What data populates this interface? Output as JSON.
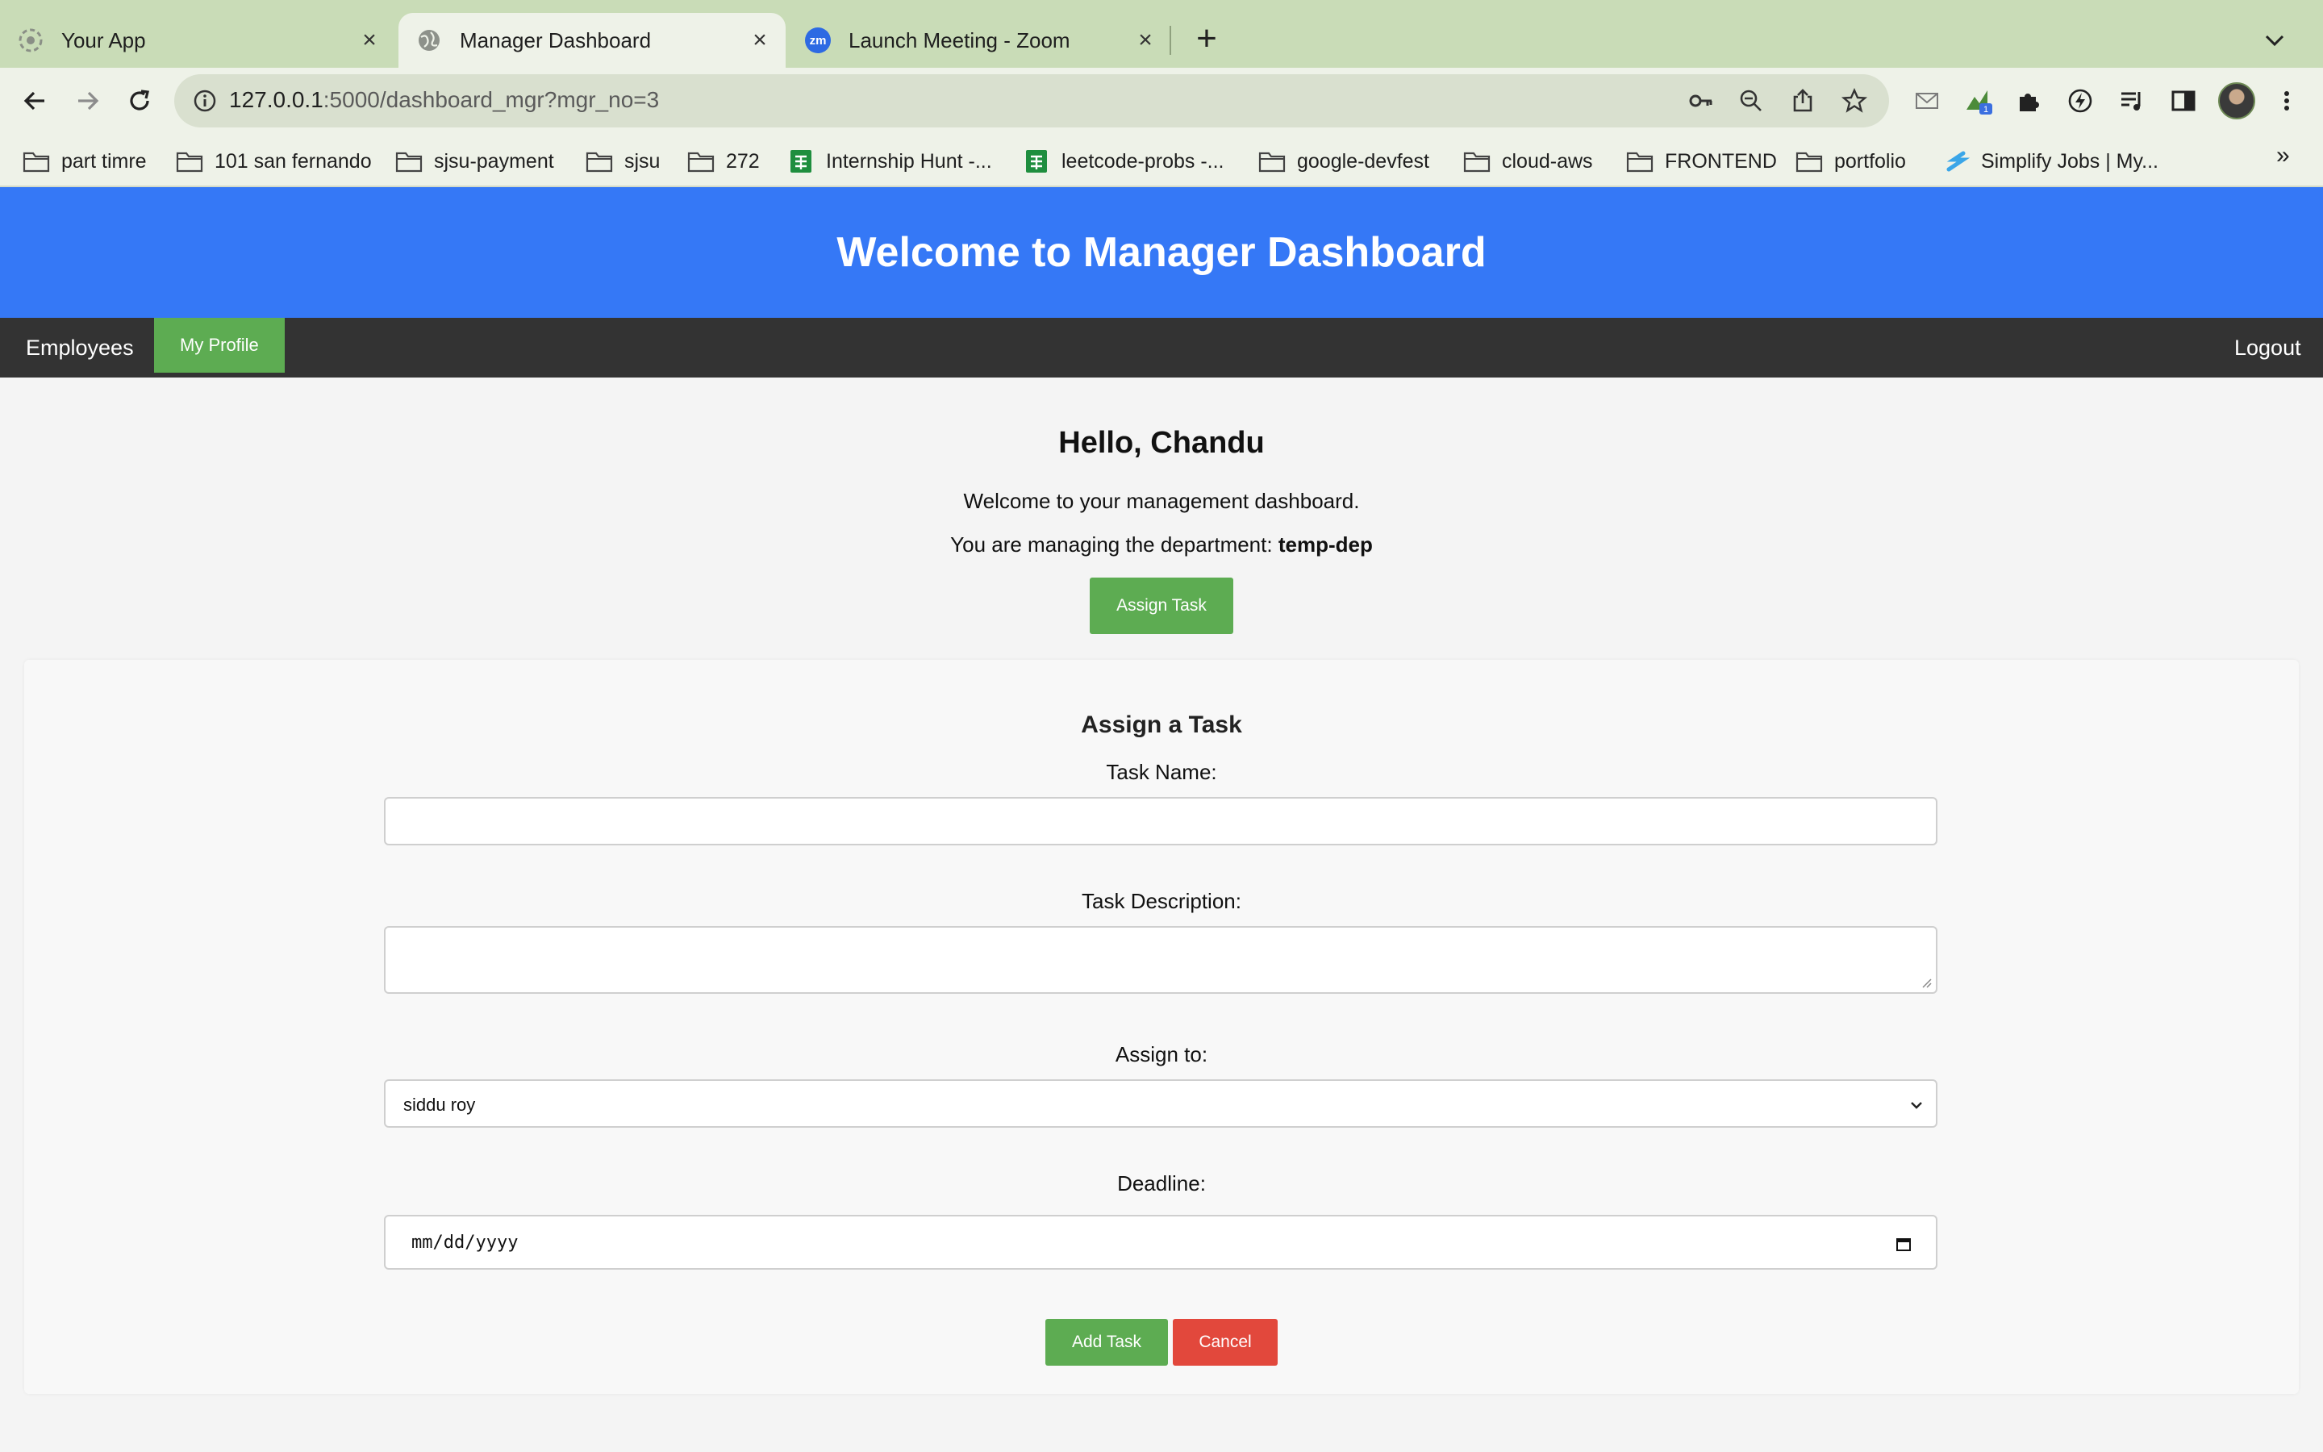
{
  "browser": {
    "tabs": [
      {
        "title": "Your App",
        "icon": "loading-spinner-icon"
      },
      {
        "title": "Manager Dashboard",
        "icon": "globe-icon"
      },
      {
        "title": "Launch Meeting - Zoom",
        "icon": "zoom-icon",
        "icon_text": "zm"
      }
    ],
    "new_tab": "+",
    "url_host": "127.0.0.1",
    "url_rest": ":5000/dashboard_mgr?mgr_no=3",
    "extension_badge": "1",
    "bookmarks": [
      {
        "label": "part timre",
        "icon": "folder-icon"
      },
      {
        "label": "101 san fernando",
        "icon": "folder-icon"
      },
      {
        "label": "sjsu-payment",
        "icon": "folder-icon"
      },
      {
        "label": "sjsu",
        "icon": "folder-icon"
      },
      {
        "label": "272",
        "icon": "folder-icon"
      },
      {
        "label": "Internship Hunt -...",
        "icon": "sheets-icon"
      },
      {
        "label": "leetcode-probs -...",
        "icon": "sheets-icon"
      },
      {
        "label": "google-devfest",
        "icon": "folder-icon"
      },
      {
        "label": "cloud-aws",
        "icon": "folder-icon"
      },
      {
        "label": "FRONTEND",
        "icon": "folder-icon"
      },
      {
        "label": "portfolio",
        "icon": "folder-icon"
      },
      {
        "label": "Simplify Jobs | My...",
        "icon": "simplify-icon"
      }
    ],
    "bookmarks_more": "»"
  },
  "header": {
    "title": "Welcome to Manager Dashboard"
  },
  "nav": {
    "employees": "Employees",
    "my_profile": "My Profile",
    "logout": "Logout"
  },
  "greeting": {
    "title": "Hello, Chandu",
    "welcome": "Welcome to your management dashboard.",
    "managing_prefix": "You are managing the department:",
    "department": "temp-dep",
    "assign_button": "Assign Task"
  },
  "form": {
    "title": "Assign a Task",
    "task_name_label": "Task Name:",
    "task_name_value": "",
    "task_desc_label": "Task Description:",
    "task_desc_value": "",
    "assign_to_label": "Assign to:",
    "assign_to_value": "siddu roy",
    "deadline_label": "Deadline:",
    "deadline_placeholder": "mm/dd/yyyy",
    "add_button": "Add Task",
    "cancel_button": "Cancel"
  },
  "colors": {
    "header_blue": "#3578f6",
    "navbar_dark": "#333333",
    "green": "#5dac52",
    "red": "#e2483c",
    "chrome_green": "#c9dcb7"
  }
}
